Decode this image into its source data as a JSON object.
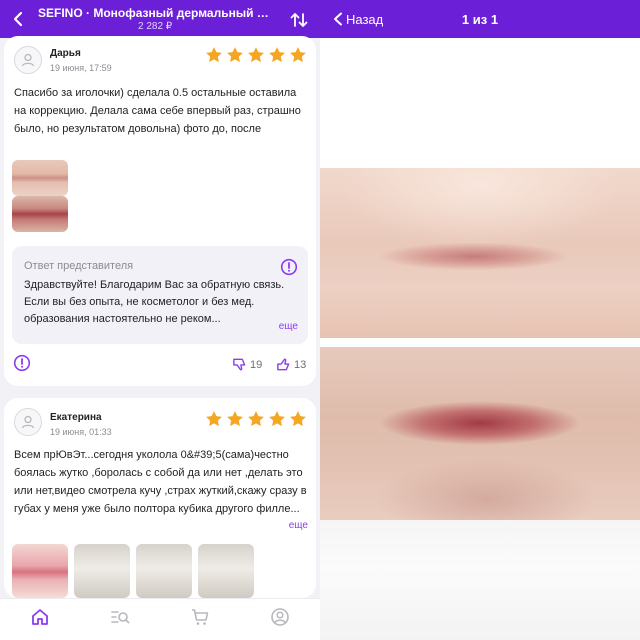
{
  "left": {
    "header": {
      "title": "SEFINO · Монофазный дермальный фи...",
      "price": "2 282 ₽"
    },
    "reviews": [
      {
        "author": "Дарья",
        "date": "19 июня, 17:59",
        "rating": 5,
        "text": "Спасибо за иголочки) сделала 0.5 остальные оставила на коррекцию. Делала сама себе впервый раз, страшно было, но результатом довольна) фото до, после",
        "reply": {
          "title": "Ответ представителя",
          "text": "Здравствуйте! Благодарим Вас за обратную связь. Если вы без опыта, не косметолог и без мед. образования настоятельно не реком...",
          "more": "еще"
        },
        "dislikes": "19",
        "likes": "13"
      },
      {
        "author": "Екатерина",
        "date": "19 июня, 01:33",
        "rating": 5,
        "text": "Всем прЮвЭт...сегодня уколола 0&#39;5(сама)честно боялась жутко ,боролась с собой да или нет ,делать это или нет,видео смотрела кучу ,страх жуткий,скажу сразу в губах у меня уже было полтора кубика другого филле...",
        "more": "еще"
      }
    ],
    "bottom_nav": [
      "home-icon",
      "catalog-icon",
      "cart-icon",
      "profile-icon"
    ]
  },
  "right": {
    "back_label": "Назад",
    "counter": "1 из 1"
  },
  "colors": {
    "brand": "#6b1fd6",
    "star": "#f5a623",
    "accent": "#8a3cf0"
  }
}
